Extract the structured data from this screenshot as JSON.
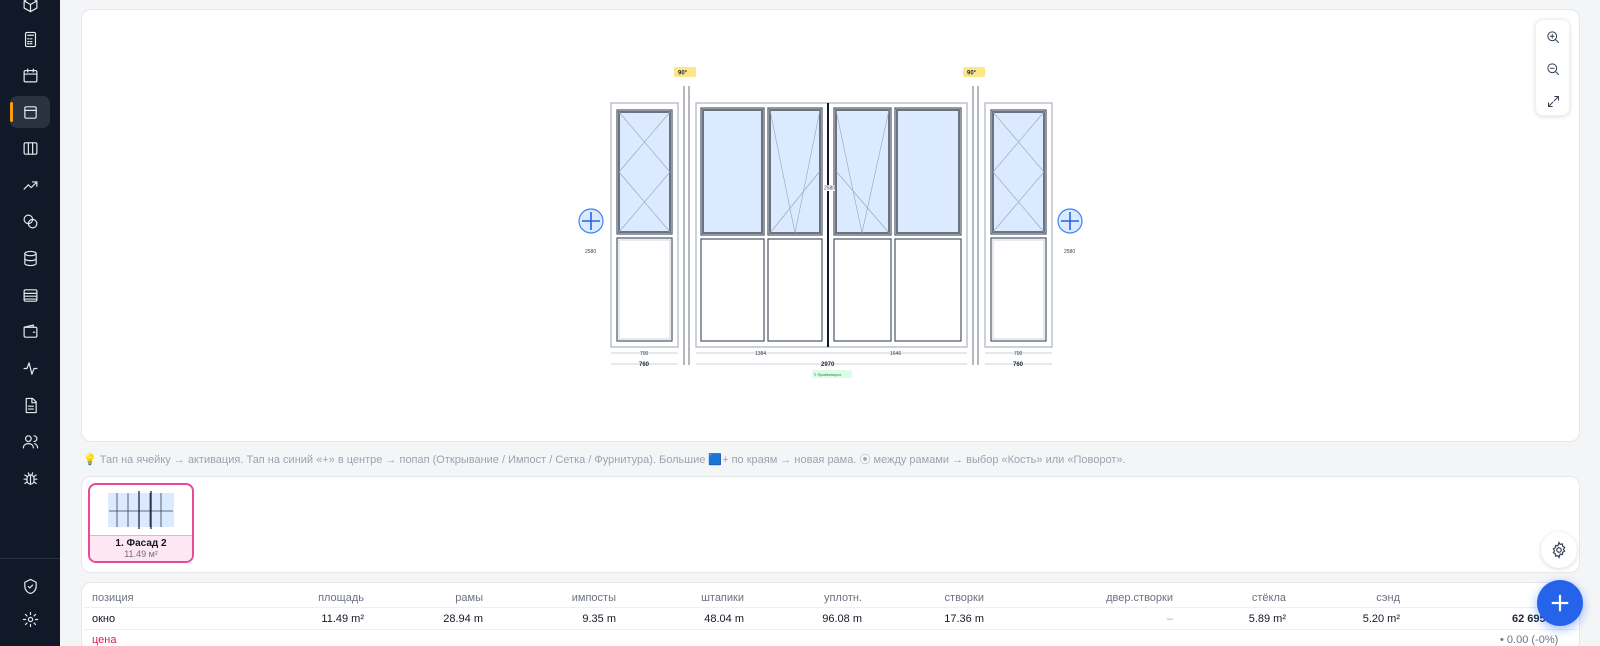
{
  "sidebar": {
    "items": [
      {
        "icon": "cube-icon"
      },
      {
        "icon": "calculator-icon"
      },
      {
        "icon": "calendar-icon"
      },
      {
        "icon": "window-icon",
        "active": true
      },
      {
        "icon": "columns-icon"
      },
      {
        "icon": "trending-up-icon"
      },
      {
        "icon": "coins-icon"
      },
      {
        "icon": "database-icon"
      },
      {
        "icon": "archive-icon"
      },
      {
        "icon": "wallet-icon"
      },
      {
        "icon": "activity-icon"
      },
      {
        "icon": "document-icon"
      },
      {
        "icon": "users-icon"
      },
      {
        "icon": "bug-icon"
      }
    ],
    "bottom": [
      {
        "icon": "shield-check-icon"
      },
      {
        "icon": "settings-icon"
      }
    ],
    "accent": "#f59e0b"
  },
  "canvas": {
    "angle_left": "90°",
    "angle_right": "90°",
    "dim_left_height": "2580",
    "dim_right_height": "2580",
    "dim_center_height": "2580",
    "dims_inner": [
      "700",
      "1384",
      "1646",
      "700"
    ],
    "dims_outer": [
      "760",
      "2970",
      "760"
    ],
    "opening_badge": "≡ Проём/порог",
    "glass_color": "#dbeafe",
    "add_button_color": "#3b82f6"
  },
  "zoom": {
    "buttons": [
      "zoom-in-icon",
      "zoom-out-icon",
      "fit-icon"
    ]
  },
  "hint": "💡 Тап на ячейку → активация. Тап на синий «+» в центре → попап (Открывание / Импост / Сетка / Фурнитура). Большие 🟦+ по краям → новая рама. ⦿ между рамами → выбор «Кость» или «Поворот».",
  "frames": [
    {
      "name": "1. Фасад 2",
      "area": "11.49 м²"
    }
  ],
  "table": {
    "headers": [
      "позиция",
      "площадь",
      "рамы",
      "импосты",
      "штапики",
      "уплотн.",
      "створки",
      "двер.створки",
      "стёкла",
      "сэнд"
    ],
    "row": {
      "position": "окно",
      "area": "11.49 m²",
      "frames": "28.94 m",
      "imposts": "9.35 m",
      "beads": "48.04 m",
      "seals": "96.08 m",
      "sashes": "17.36 m",
      "door_sashes": "–",
      "glass": "5.89 m²",
      "sand": "5.20 m²",
      "total": "62 695"
    },
    "price_label": "цена",
    "discount": "• 0.00 (-0%)"
  }
}
